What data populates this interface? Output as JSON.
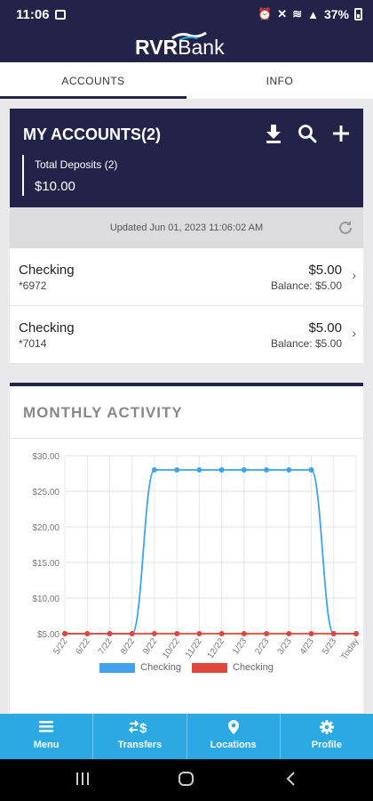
{
  "status_bar": {
    "time": "11:06",
    "battery": "37%"
  },
  "app": {
    "logo_rvr": "RVR",
    "logo_bank": "Bank"
  },
  "tabs": [
    {
      "label": "ACCOUNTS",
      "active": true
    },
    {
      "label": "INFO",
      "active": false
    }
  ],
  "accounts": {
    "title": "MY ACCOUNTS(2)",
    "total_label": "Total Deposits (2)",
    "total_amount": "$10.00",
    "updated_label": "Updated",
    "updated_time": "Jun 01, 2023 11:06:02 AM",
    "items": [
      {
        "name": "Checking",
        "number": "*6972",
        "amount": "$5.00",
        "balance": "Balance: $5.00"
      },
      {
        "name": "Checking",
        "number": "*7014",
        "amount": "$5.00",
        "balance": "Balance: $5.00"
      }
    ]
  },
  "activity": {
    "title": "MONTHLY ACTIVITY"
  },
  "chart_data": {
    "type": "line",
    "categories": [
      "5/22",
      "6/22",
      "7/22",
      "8/22",
      "9/22",
      "10/22",
      "11/22",
      "12/22",
      "1/23",
      "2/23",
      "3/23",
      "4/23",
      "5/23",
      "Today"
    ],
    "y_ticks": [
      "$5.00",
      "$10.00",
      "$15.00",
      "$20.00",
      "$25.00",
      "$30.00"
    ],
    "ylim": [
      5,
      30
    ],
    "grid": true,
    "legend_position": "bottom",
    "series": [
      {
        "name": "Checking",
        "color": "#3ea3ec",
        "values": [
          5,
          5,
          5,
          5,
          28,
          28,
          28,
          28,
          28,
          28,
          28,
          28,
          5,
          5
        ]
      },
      {
        "name": "Checking",
        "color": "#e0473a",
        "values": [
          5,
          5,
          5,
          5,
          5,
          5,
          5,
          5,
          5,
          5,
          5,
          5,
          5,
          5
        ]
      }
    ]
  },
  "bottom_nav": [
    {
      "label": "Menu",
      "icon": "menu-icon"
    },
    {
      "label": "Transfers",
      "icon": "transfers-icon"
    },
    {
      "label": "Locations",
      "icon": "location-pin-icon"
    },
    {
      "label": "Profile",
      "icon": "gear-icon"
    }
  ],
  "colors": {
    "navy": "#23234a",
    "accent": "#2aa9e3"
  }
}
